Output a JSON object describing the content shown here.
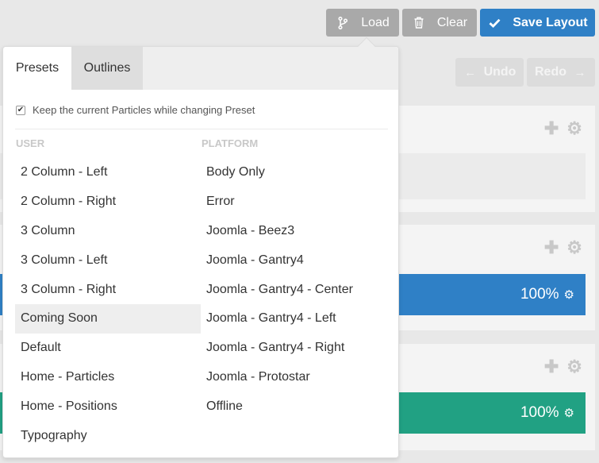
{
  "toolbar": {
    "load_label": "Load",
    "clear_label": "Clear",
    "save_label": "Save Layout",
    "undo_label": "Undo",
    "redo_label": "Redo",
    "icons": {
      "load": "branch-icon",
      "clear": "trash-icon",
      "save": "check-icon",
      "undo": "arrow-left-icon",
      "redo": "arrow-right-icon"
    }
  },
  "sections": [
    {
      "tools": [
        "plus-icon",
        "gear-icon"
      ]
    },
    {
      "tools": [
        "plus-icon",
        "gear-icon"
      ],
      "bar": {
        "size_label": "100%",
        "color": "#2f80c6"
      }
    },
    {
      "tools": [
        "plus-icon",
        "gear-icon"
      ],
      "bar": {
        "size_label": "100%",
        "color": "#21a183"
      }
    }
  ],
  "popover": {
    "tabs": [
      {
        "label": "Presets",
        "active": true
      },
      {
        "label": "Outlines",
        "active": false
      }
    ],
    "keep_particles": {
      "label": "Keep the current Particles while changing Preset",
      "checked": true
    },
    "user_heading": "USER",
    "platform_heading": "PLATFORM",
    "user_items": [
      "2 Column - Left",
      "2 Column - Right",
      "3 Column",
      "3 Column - Left",
      "3 Column - Right",
      "Coming Soon",
      "Default",
      "Home - Particles",
      "Home - Positions",
      "Typography"
    ],
    "platform_items": [
      "Body Only",
      "Error",
      "Joomla - Beez3",
      "Joomla - Gantry4",
      "Joomla - Gantry4 - Center",
      "Joomla - Gantry4 - Left",
      "Joomla - Gantry4 - Right",
      "Joomla - Protostar",
      "Offline"
    ],
    "hovered_item": "Coming Soon"
  }
}
